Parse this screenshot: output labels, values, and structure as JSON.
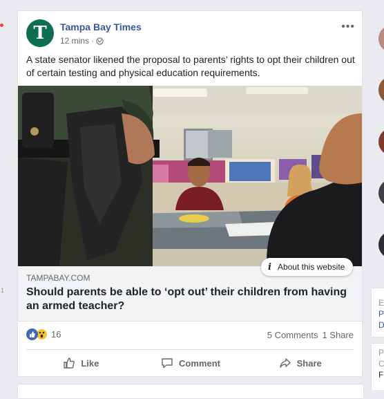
{
  "post": {
    "page_name": "Tampa Bay Times",
    "avatar_letter": "T",
    "time": "12 mins",
    "sep": "·",
    "body": "A state senator likened the proposal to parents’ rights to opt their children out of certain testing and physical education requirements.",
    "about_website": "About this website",
    "link": {
      "domain": "TAMPABAY.COM",
      "headline": "Should parents be able to ‘opt out’ their children from having an armed teacher?"
    },
    "reaction_count": "16",
    "comments": "5 Comments",
    "shares": "1 Share",
    "actions": {
      "like": "Like",
      "comment": "Comment",
      "share": "Share"
    }
  },
  "left_strip": {
    "number": "1"
  },
  "right_column": {
    "letters": [
      "E",
      "P",
      "D",
      "P",
      "C",
      "F"
    ]
  },
  "colors": {
    "brand_blue": "#365899",
    "avatar_green": "#0f6e52",
    "like_blue": "#4267b2",
    "wow_yellow": "#f7c231"
  },
  "icons": [
    "globe-icon",
    "more-icon",
    "info-icon",
    "like-icon",
    "comment-icon",
    "share-icon",
    "like-reaction-icon",
    "wow-reaction-icon"
  ]
}
